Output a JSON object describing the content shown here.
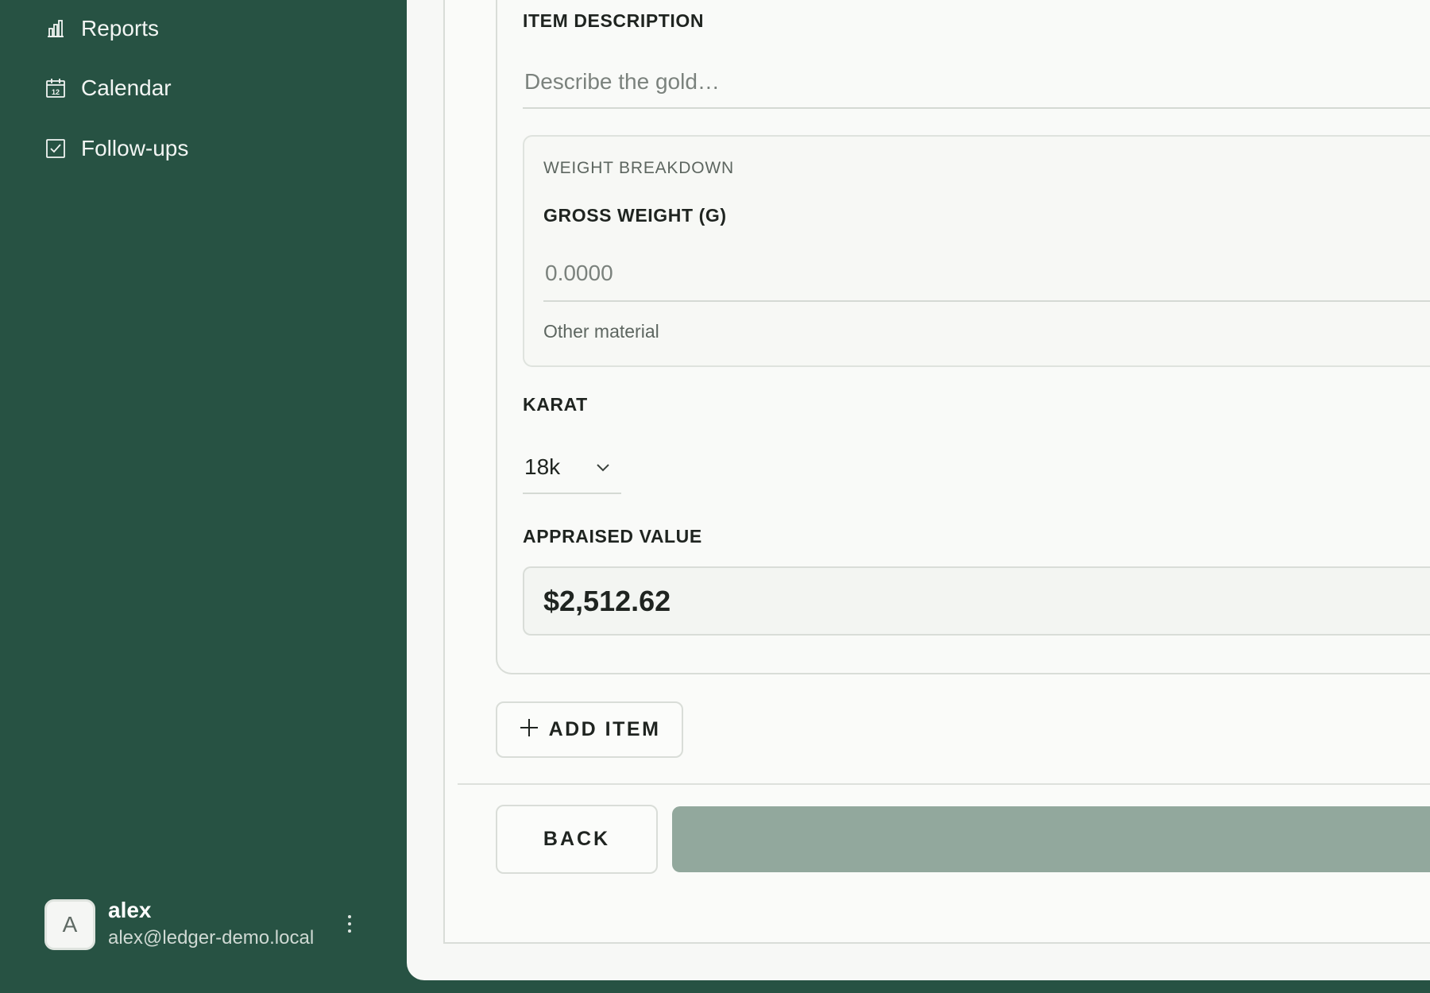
{
  "sidebar": {
    "nav": [
      {
        "label": "Reports",
        "icon": "bar-chart-icon"
      },
      {
        "label": "Calendar",
        "icon": "calendar-icon"
      },
      {
        "label": "Follow-ups",
        "icon": "checkbox-icon"
      }
    ],
    "calendar_icon_day": "12",
    "user": {
      "initial": "A",
      "name": "alex",
      "email": "alex@ledger-demo.local"
    }
  },
  "form": {
    "item_description": {
      "label": "ITEM DESCRIPTION",
      "placeholder": "Describe the gold…",
      "value": ""
    },
    "weight_breakdown": {
      "title": "WEIGHT BREAKDOWN",
      "gross_weight_label": "GROSS WEIGHT (G)",
      "gross_weight_placeholder": "0.0000",
      "gross_weight_value": "",
      "other_material_label": "Other material"
    },
    "karat": {
      "label": "KARAT",
      "selected": "18k"
    },
    "appraised_value": {
      "label": "APPRAISED VALUE",
      "value": "$2,512.62"
    },
    "add_item_label": "ADD ITEM",
    "back_label": "BACK",
    "continue_label": ""
  },
  "colors": {
    "sidebar_bg": "#275243",
    "main_bg": "#f7f8f6",
    "primary_disabled": "#92a89d"
  }
}
